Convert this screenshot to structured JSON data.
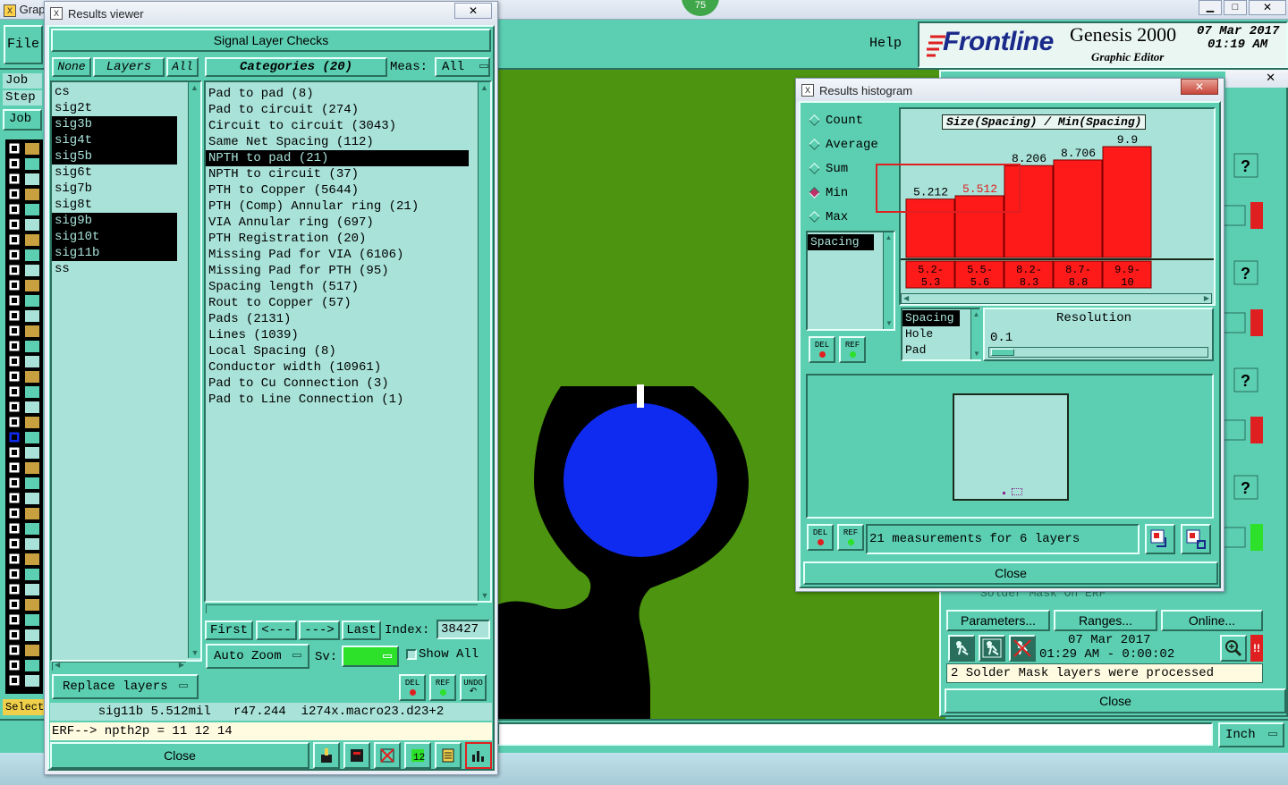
{
  "background_app": {
    "title_left": "Grap",
    "menu_file": "File",
    "menu_help": "Help",
    "sidebar_labels": [
      "Job",
      "Step",
      "Job"
    ],
    "select_label": "Select",
    "brand": "Frontline",
    "product": "Genesis 2000",
    "product_sub": "Graphic Editor",
    "date": "07 Mar 2017",
    "time": "01:19 AM",
    "badge": "75",
    "unit_label": "Inch"
  },
  "results_viewer": {
    "title": "Results viewer",
    "header": "Signal Layer Checks",
    "layer_tabs": [
      "None",
      "Layers",
      "All"
    ],
    "categories_label": "Categories (20)",
    "meas_label": "Meas:",
    "meas_value": "All",
    "layers": [
      {
        "name": "cs",
        "selected": false
      },
      {
        "name": "sig2t",
        "selected": false
      },
      {
        "name": "sig3b",
        "selected": true
      },
      {
        "name": "sig4t",
        "selected": true
      },
      {
        "name": "sig5b",
        "selected": true
      },
      {
        "name": "sig6t",
        "selected": false
      },
      {
        "name": "sig7b",
        "selected": false
      },
      {
        "name": "sig8t",
        "selected": false
      },
      {
        "name": "sig9b",
        "selected": true
      },
      {
        "name": "sig10t",
        "selected": true
      },
      {
        "name": "sig11b",
        "selected": true
      },
      {
        "name": "ss",
        "selected": false
      }
    ],
    "categories": [
      {
        "name": "Pad to pad (8)",
        "selected": false
      },
      {
        "name": "Pad to circuit (274)",
        "selected": false
      },
      {
        "name": "Circuit to circuit (3043)",
        "selected": false
      },
      {
        "name": "Same Net Spacing (112)",
        "selected": false
      },
      {
        "name": "NPTH to pad (21)",
        "selected": true
      },
      {
        "name": "NPTH to circuit (37)",
        "selected": false
      },
      {
        "name": "PTH to Copper (5644)",
        "selected": false
      },
      {
        "name": "PTH (Comp) Annular ring (21)",
        "selected": false
      },
      {
        "name": "VIA Annular ring (697)",
        "selected": false
      },
      {
        "name": "PTH Registration (20)",
        "selected": false
      },
      {
        "name": "Missing Pad for VIA (6106)",
        "selected": false
      },
      {
        "name": "Missing Pad for PTH (95)",
        "selected": false
      },
      {
        "name": "Spacing length (517)",
        "selected": false
      },
      {
        "name": "Rout to Copper (57)",
        "selected": false
      },
      {
        "name": "Pads (2131)",
        "selected": false
      },
      {
        "name": "Lines (1039)",
        "selected": false
      },
      {
        "name": "Local Spacing (8)",
        "selected": false
      },
      {
        "name": "Conductor width (10961)",
        "selected": false
      },
      {
        "name": "Pad to Cu Connection (3)",
        "selected": false
      },
      {
        "name": "Pad to Line Connection (1)",
        "selected": false
      }
    ],
    "nav": {
      "first": "First",
      "prev": "<---",
      "next": "--->",
      "last": "Last",
      "index_label": "Index:",
      "index_value": "38427"
    },
    "auto_zoom": "Auto Zoom",
    "sv_label": "Sv:",
    "show_all": "Show All",
    "replace_layers": "Replace layers",
    "icon_labels": {
      "del": "DEL",
      "ref": "REF",
      "undo": "UNDO"
    },
    "status_line": "sig11b 5.512mil   r47.244  i274x.macro23.d23+2",
    "erf_line": "ERF--> npth2p = 11 12 14",
    "close": "Close"
  },
  "histogram": {
    "title": "Results histogram",
    "modes": [
      {
        "label": "Count",
        "on": false
      },
      {
        "label": "Average",
        "on": false
      },
      {
        "label": "Sum",
        "on": false
      },
      {
        "label": "Min",
        "on": true
      },
      {
        "label": "Max",
        "on": false
      }
    ],
    "measure_list": [
      "Spacing"
    ],
    "chart_title": "Size(Spacing) / Min(Spacing)",
    "bars": [
      {
        "range_top": "5.2-",
        "range_bot": "5.3",
        "value": 5.212,
        "label": "5.212",
        "highlight": false
      },
      {
        "range_top": "5.5-",
        "range_bot": "5.6",
        "value": 5.512,
        "label": "5.512",
        "highlight": true
      },
      {
        "range_top": "8.2-",
        "range_bot": "8.3",
        "value": 8.206,
        "label": "8.206",
        "highlight": false
      },
      {
        "range_top": "8.7-",
        "range_bot": "8.8",
        "value": 8.706,
        "label": "8.706",
        "highlight": false
      },
      {
        "range_top": "9.9-",
        "range_bot": "10",
        "value": 9.9,
        "label": "9.9",
        "highlight": false
      }
    ],
    "size_list": [
      {
        "label": "Spacing",
        "selected": true
      },
      {
        "label": "Hole",
        "selected": false
      },
      {
        "label": "Pad",
        "selected": false
      }
    ],
    "resolution_label": "Resolution",
    "resolution_value": "0.1",
    "measurement_text": "21 measurements for 6 layers",
    "close": "Close"
  },
  "solder_panel": {
    "parameters": "Parameters...",
    "ranges": "Ranges...",
    "online": "Online...",
    "date": "07 Mar 2017",
    "time": "01:29 AM - 0:00:02",
    "message": "2 Solder Mask layers were processed",
    "close": "Close",
    "partial_title": "Solder Mask On ERF"
  },
  "colors": {
    "panel_teal": "#5ccfb2",
    "list_bg": "#a8e2d8",
    "canvas_green": "#4d9410",
    "pad_blue": "#0f2bf0",
    "bar_red": "#ff1a1a",
    "accent_red": "#e02020"
  }
}
